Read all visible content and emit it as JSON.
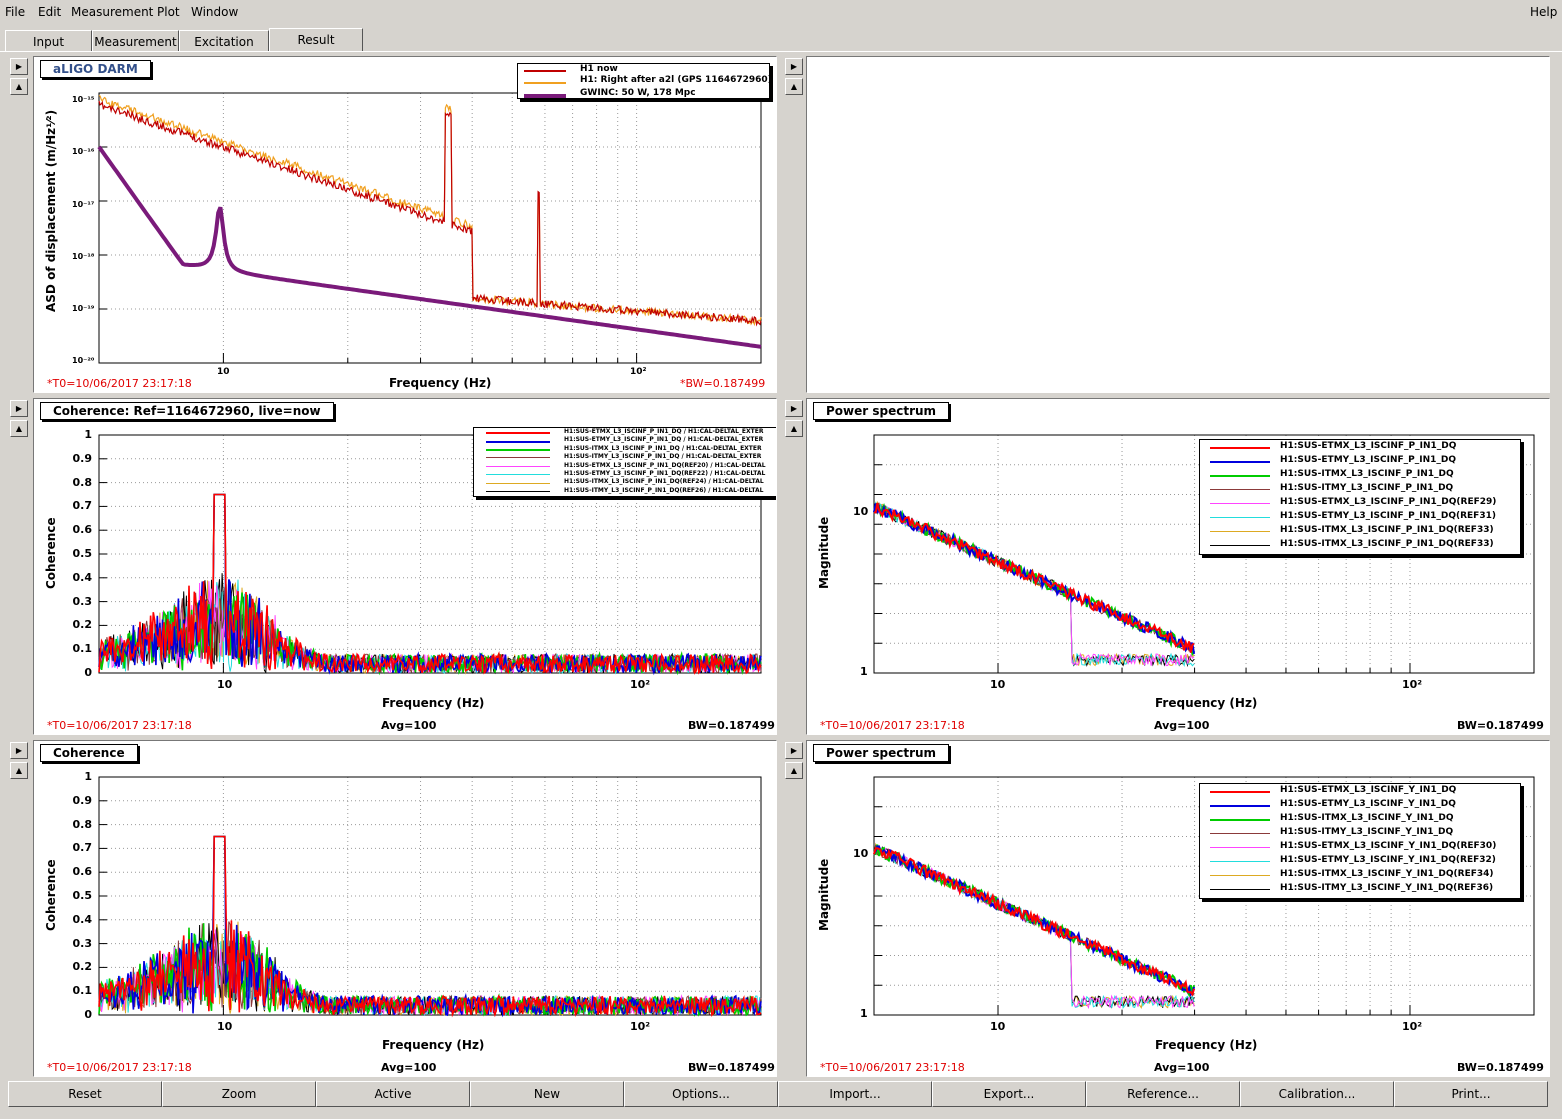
{
  "menubar": {
    "file": "File",
    "edit": "Edit",
    "measurement": "Measurement",
    "plot": "Plot",
    "window": "Window",
    "help": "Help"
  },
  "tabs": [
    "Input",
    "Measurement",
    "Excitation",
    "Result"
  ],
  "active_tab": "Result",
  "plots": {
    "darm": {
      "title": "aLIGO DARM",
      "ylabel": "ASD of displacement (m/Hz¹⁄²)",
      "xlabel": "Frequency (Hz)",
      "t0": "*T0=10/06/2017 23:17:18",
      "bw": "*BW=0.187499",
      "legend": [
        {
          "label": "H1 now",
          "color": "#c00000"
        },
        {
          "label": "H1: Right after a2l (GPS 1164672960)",
          "color": "#f0a020"
        },
        {
          "label": "GWINC: 50 W, 178 Mpc",
          "color": "#7a1a7a"
        }
      ],
      "yticks": [
        "10⁻¹⁵",
        "10⁻¹⁶",
        "10⁻¹⁷",
        "10⁻¹⁸",
        "10⁻¹⁹",
        "10⁻²⁰"
      ],
      "xticks": [
        "10",
        "10²"
      ]
    },
    "coh1": {
      "title": "Coherence: Ref=1164672960, live=now",
      "ylabel": "Coherence",
      "xlabel": "Frequency (Hz)",
      "t0": "*T0=10/06/2017 23:17:18",
      "avg": "Avg=100",
      "bw": "BW=0.187499",
      "legend": [
        {
          "label": "H1:SUS-ETMX_L3_ISCINF_P_IN1_DQ / H1:CAL-DELTAL_EXTER",
          "color": "#ff0000"
        },
        {
          "label": "H1:SUS-ETMY_L3_ISCINF_P_IN1_DQ / H1:CAL-DELTAL_EXTER",
          "color": "#0000dd"
        },
        {
          "label": "H1:SUS-ITMX_L3_ISCINF_P_IN1_DQ / H1:CAL-DELTAL_EXTER",
          "color": "#00cc00"
        },
        {
          "label": "H1:SUS-ITMY_L3_ISCINF_P_IN1_DQ / H1:CAL-DELTAL_EXTER",
          "color": "#8b3a3a"
        },
        {
          "label": "H1:SUS-ETMX_L3_ISCINF_P_IN1_DQ(REF20) / H1:CAL-DELTAL",
          "color": "#ff44ff"
        },
        {
          "label": "H1:SUS-ETMY_L3_ISCINF_P_IN1_DQ(REF22) / H1:CAL-DELTAL",
          "color": "#22dddd"
        },
        {
          "label": "H1:SUS-ITMX_L3_ISCINF_P_IN1_DQ(REF24) / H1:CAL-DELTAL",
          "color": "#ddaa22"
        },
        {
          "label": "H1:SUS-ITMY_L3_ISCINF_P_IN1_DQ(REF26) / H1:CAL-DELTAL",
          "color": "#000000"
        }
      ],
      "yticks": [
        "1",
        "0.9",
        "0.8",
        "0.7",
        "0.6",
        "0.5",
        "0.4",
        "0.3",
        "0.2",
        "0.1",
        "0"
      ],
      "xticks": [
        "10",
        "10²"
      ]
    },
    "psd1": {
      "title": "Power spectrum",
      "ylabel": "Magnitude",
      "xlabel": "Frequency (Hz)",
      "t0": "*T0=10/06/2017 23:17:18",
      "avg": "Avg=100",
      "bw": "BW=0.187499",
      "legend": [
        {
          "label": "H1:SUS-ETMX_L3_ISCINF_P_IN1_DQ",
          "color": "#ff0000"
        },
        {
          "label": "H1:SUS-ETMY_L3_ISCINF_P_IN1_DQ",
          "color": "#0000dd"
        },
        {
          "label": "H1:SUS-ITMX_L3_ISCINF_P_IN1_DQ",
          "color": "#00cc00"
        },
        {
          "label": "H1:SUS-ITMY_L3_ISCINF_P_IN1_DQ",
          "color": "#8b3a3a"
        },
        {
          "label": "H1:SUS-ETMX_L3_ISCINF_P_IN1_DQ(REF29)",
          "color": "#ff44ff"
        },
        {
          "label": "H1:SUS-ETMY_L3_ISCINF_P_IN1_DQ(REF31)",
          "color": "#22dddd"
        },
        {
          "label": "H1:SUS-ITMX_L3_ISCINF_P_IN1_DQ(REF33)",
          "color": "#ddaa22"
        },
        {
          "label": "H1:SUS-ITMX_L3_ISCINF_P_IN1_DQ(REF33)",
          "color": "#000000"
        }
      ],
      "yticks": [
        "10",
        "1"
      ],
      "xticks": [
        "10",
        "10²"
      ]
    },
    "coh2": {
      "title": "Coherence",
      "ylabel": "Coherence",
      "xlabel": "Frequency (Hz)",
      "t0": "*T0=10/06/2017 23:17:18",
      "avg": "Avg=100",
      "bw": "BW=0.187499",
      "yticks": [
        "1",
        "0.9",
        "0.8",
        "0.7",
        "0.6",
        "0.5",
        "0.4",
        "0.3",
        "0.2",
        "0.1",
        "0"
      ],
      "xticks": [
        "10",
        "10²"
      ]
    },
    "psd2": {
      "title": "Power spectrum",
      "ylabel": "Magnitude",
      "xlabel": "Frequency (Hz)",
      "t0": "*T0=10/06/2017 23:17:18",
      "avg": "Avg=100",
      "bw": "BW=0.187499",
      "legend": [
        {
          "label": "H1:SUS-ETMX_L3_ISCINF_Y_IN1_DQ",
          "color": "#ff0000"
        },
        {
          "label": "H1:SUS-ETMY_L3_ISCINF_Y_IN1_DQ",
          "color": "#0000dd"
        },
        {
          "label": "H1:SUS-ITMX_L3_ISCINF_Y_IN1_DQ",
          "color": "#00cc00"
        },
        {
          "label": "H1:SUS-ITMY_L3_ISCINF_Y_IN1_DQ",
          "color": "#8b3a3a"
        },
        {
          "label": "H1:SUS-ETMX_L3_ISCINF_Y_IN1_DQ(REF30)",
          "color": "#ff44ff"
        },
        {
          "label": "H1:SUS-ETMY_L3_ISCINF_Y_IN1_DQ(REF32)",
          "color": "#22dddd"
        },
        {
          "label": "H1:SUS-ITMX_L3_ISCINF_Y_IN1_DQ(REF34)",
          "color": "#ddaa22"
        },
        {
          "label": "H1:SUS-ITMY_L3_ISCINF_Y_IN1_DQ(REF36)",
          "color": "#000000"
        }
      ],
      "yticks": [
        "10",
        "1"
      ],
      "xticks": [
        "10",
        "10²"
      ]
    }
  },
  "buttons": [
    "Reset",
    "Zoom",
    "Active",
    "New",
    "Options...",
    "Import...",
    "Export...",
    "Reference...",
    "Calibration...",
    "Print..."
  ]
}
